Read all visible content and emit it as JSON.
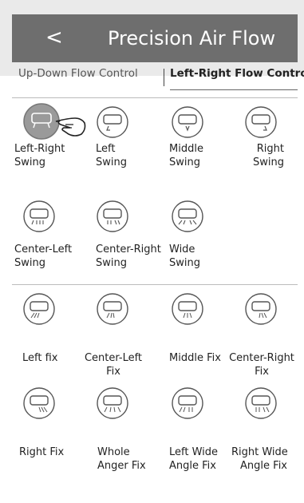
{
  "header": {
    "back_label": "<",
    "title": "Precision Air Flow"
  },
  "tabs": [
    {
      "label": "Up-Down Flow Control",
      "active": false
    },
    {
      "label": "Left-Right Flow Control",
      "active": true
    }
  ],
  "swing_modes": [
    {
      "label1": "Left-Right",
      "label2": "Swing",
      "icon": "ac-left-right-swing-icon",
      "selected": true
    },
    {
      "label1": "Left",
      "label2": "Swing",
      "icon": "ac-left-swing-icon",
      "selected": false
    },
    {
      "label1": "Middle",
      "label2": "Swing",
      "icon": "ac-middle-swing-icon",
      "selected": false
    },
    {
      "label1": "Right",
      "label2": "Swing",
      "icon": "ac-right-swing-icon",
      "selected": false
    },
    {
      "label1": "Center-Left",
      "label2": "Swing",
      "icon": "ac-center-left-swing-icon",
      "selected": false
    },
    {
      "label1": "Center-Right",
      "label2": "Swing",
      "icon": "ac-center-right-swing-icon",
      "selected": false
    },
    {
      "label1": "Wide",
      "label2": "Swing",
      "icon": "ac-wide-swing-icon",
      "selected": false
    }
  ],
  "fix_modes": [
    {
      "label1": "Left fix",
      "label2": "",
      "icon": "ac-left-fix-icon"
    },
    {
      "label1": "Center-Left",
      "label2": "Fix",
      "icon": "ac-center-left-fix-icon"
    },
    {
      "label1": "Middle Fix",
      "label2": "",
      "icon": "ac-middle-fix-icon"
    },
    {
      "label1": "Center-Right",
      "label2": "Fix",
      "icon": "ac-center-right-fix-icon"
    },
    {
      "label1": "Right Fix",
      "label2": "",
      "icon": "ac-right-fix-icon"
    },
    {
      "label1": "Whole",
      "label2": "Anger Fix",
      "icon": "ac-whole-angle-fix-icon"
    },
    {
      "label1": "Left Wide",
      "label2": "Angle Fix",
      "icon": "ac-left-wide-angle-fix-icon"
    },
    {
      "label1": "Right Wide",
      "label2": "Angle Fix",
      "icon": "ac-right-wide-angle-fix-icon"
    }
  ],
  "colors": {
    "header_bg": "#6e6e6e",
    "selected_icon_bg": "#9a9a9a",
    "page_bg": "#eaeaea"
  }
}
